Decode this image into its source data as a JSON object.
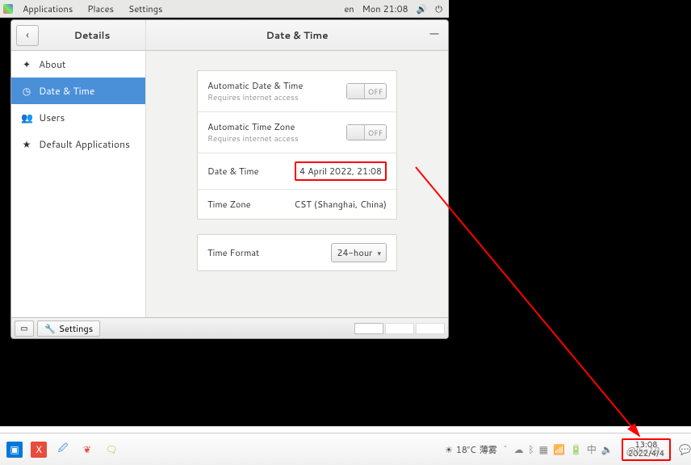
{
  "topbar": {
    "applications": "Applications",
    "places": "Places",
    "settings": "Settings",
    "lang": "en",
    "datetime": "Mon 21:08"
  },
  "window": {
    "left_title": "Details",
    "right_title": "Date & Time"
  },
  "sidebar": {
    "items": [
      {
        "icon": "✦",
        "label": "About"
      },
      {
        "icon": "◷",
        "label": "Date & Time"
      },
      {
        "icon": "👥",
        "label": "Users"
      },
      {
        "icon": "★",
        "label": "Default Applications"
      }
    ]
  },
  "settings": {
    "auto_dt_label": "Automatic Date & Time",
    "auto_dt_sub": "Requires internet access",
    "auto_dt_state": "OFF",
    "auto_tz_label": "Automatic Time Zone",
    "auto_tz_sub": "Requires internet access",
    "auto_tz_state": "OFF",
    "dt_label": "Date & Time",
    "dt_value": "4 April 2022, 21:08",
    "tz_label": "Time Zone",
    "tz_value": "CST (Shanghai, China)",
    "fmt_label": "Time Format",
    "fmt_value": "24-hour"
  },
  "taskpanel": {
    "app": "Settings"
  },
  "host": {
    "weather_temp": "18°C",
    "weather_cond": "薄雾",
    "watermark": "@lhg19",
    "clock_time": "13:08",
    "clock_date": "2022/4/4"
  }
}
